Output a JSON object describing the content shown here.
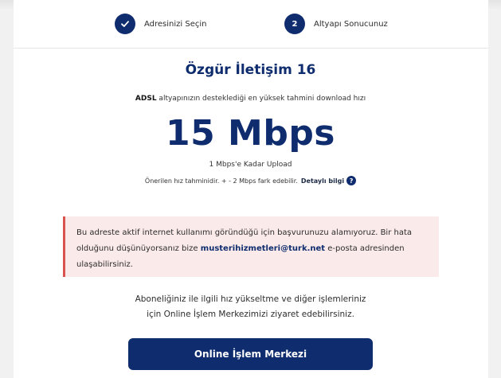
{
  "stepper": {
    "steps": [
      {
        "icon": "check-icon",
        "number": "",
        "label": "Adresinizi Seçin",
        "state": "completed"
      },
      {
        "icon": "",
        "number": "2",
        "label": "Altyapı Sonucunuz",
        "state": "active"
      }
    ]
  },
  "result": {
    "title": "Özgür İletişim 16",
    "subtitle_strong": "ADSL",
    "subtitle_rest": " altyapınızın desteklediği en yüksek tahmini download hızı",
    "speed": "15 Mbps",
    "upload": "1 Mbps'e Kadar Upload",
    "note": "Önerilen hız tahminidir. + - 2 Mbps fark edebilir.",
    "detail_link": "Detaylı bilgi",
    "help_glyph": "?"
  },
  "alert": {
    "text_before": "Bu adreste aktif internet kullanımı göründüğü için başvurunuzu alamıyoruz. Bir hata olduğunu düşünüyorsanız bize ",
    "email": "musterihizmetleri@turk.net",
    "text_after": " e-posta adresinden ulaşabilirsiniz.",
    "color": "#d9534f",
    "background": "#fbeaea"
  },
  "info": {
    "line1": "Aboneliğiniz ile ilgili hız yükseltme ve diğer işlemleriniz",
    "line2": "için Online İşlem Merkezimizi ziyaret edebilirsiniz."
  },
  "cta": {
    "label": "Online İşlem Merkezi"
  },
  "colors": {
    "brand": "#0f2d6e",
    "alert_border": "#d9534f"
  }
}
